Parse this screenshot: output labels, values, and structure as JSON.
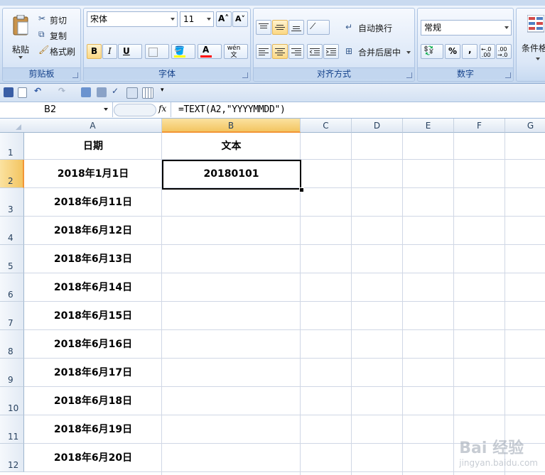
{
  "ribbon": {
    "groups": {
      "clipboard": {
        "label": "剪贴板",
        "paste": "粘贴",
        "cut": "剪切",
        "copy": "复制",
        "format_painter": "格式刷"
      },
      "font": {
        "label": "字体",
        "font_name": "宋体",
        "font_size": "11",
        "bold": "B",
        "italic": "I",
        "underline": "U",
        "font_color_letter": "A",
        "phonetic": "wén 文"
      },
      "alignment": {
        "label": "对齐方式",
        "wrap_text": "自动换行",
        "merge_center": "合并后居中"
      },
      "number": {
        "label": "数字",
        "format": "常规",
        "percent": "%",
        "comma": ","
      },
      "styles": {
        "label": "条件格"
      }
    }
  },
  "formula_bar": {
    "name_box": "B2",
    "fx": "fx",
    "formula": "=TEXT(A2,\"YYYYMMDD\")"
  },
  "columns": [
    "A",
    "B",
    "C",
    "D",
    "E",
    "F",
    "G"
  ],
  "rows": [
    "1",
    "2",
    "3",
    "4",
    "5",
    "6",
    "7",
    "8",
    "9",
    "10",
    "11",
    "12"
  ],
  "cells": {
    "A": [
      "日期",
      "2018年1月1日",
      "2018年6月11日",
      "2018年6月12日",
      "2018年6月13日",
      "2018年6月14日",
      "2018年6月15日",
      "2018年6月16日",
      "2018年6月17日",
      "2018年6月18日",
      "2018年6月19日",
      "2018年6月20日"
    ],
    "B": [
      "文本",
      "20180101",
      "",
      "",
      "",
      "",
      "",
      "",
      "",
      "",
      "",
      ""
    ]
  },
  "watermark": {
    "brand": "Bai 经验",
    "url": "jingyan.baidu.com"
  },
  "colors": {
    "selection_header": "#f3c561",
    "ribbon_text": "#15428b"
  }
}
